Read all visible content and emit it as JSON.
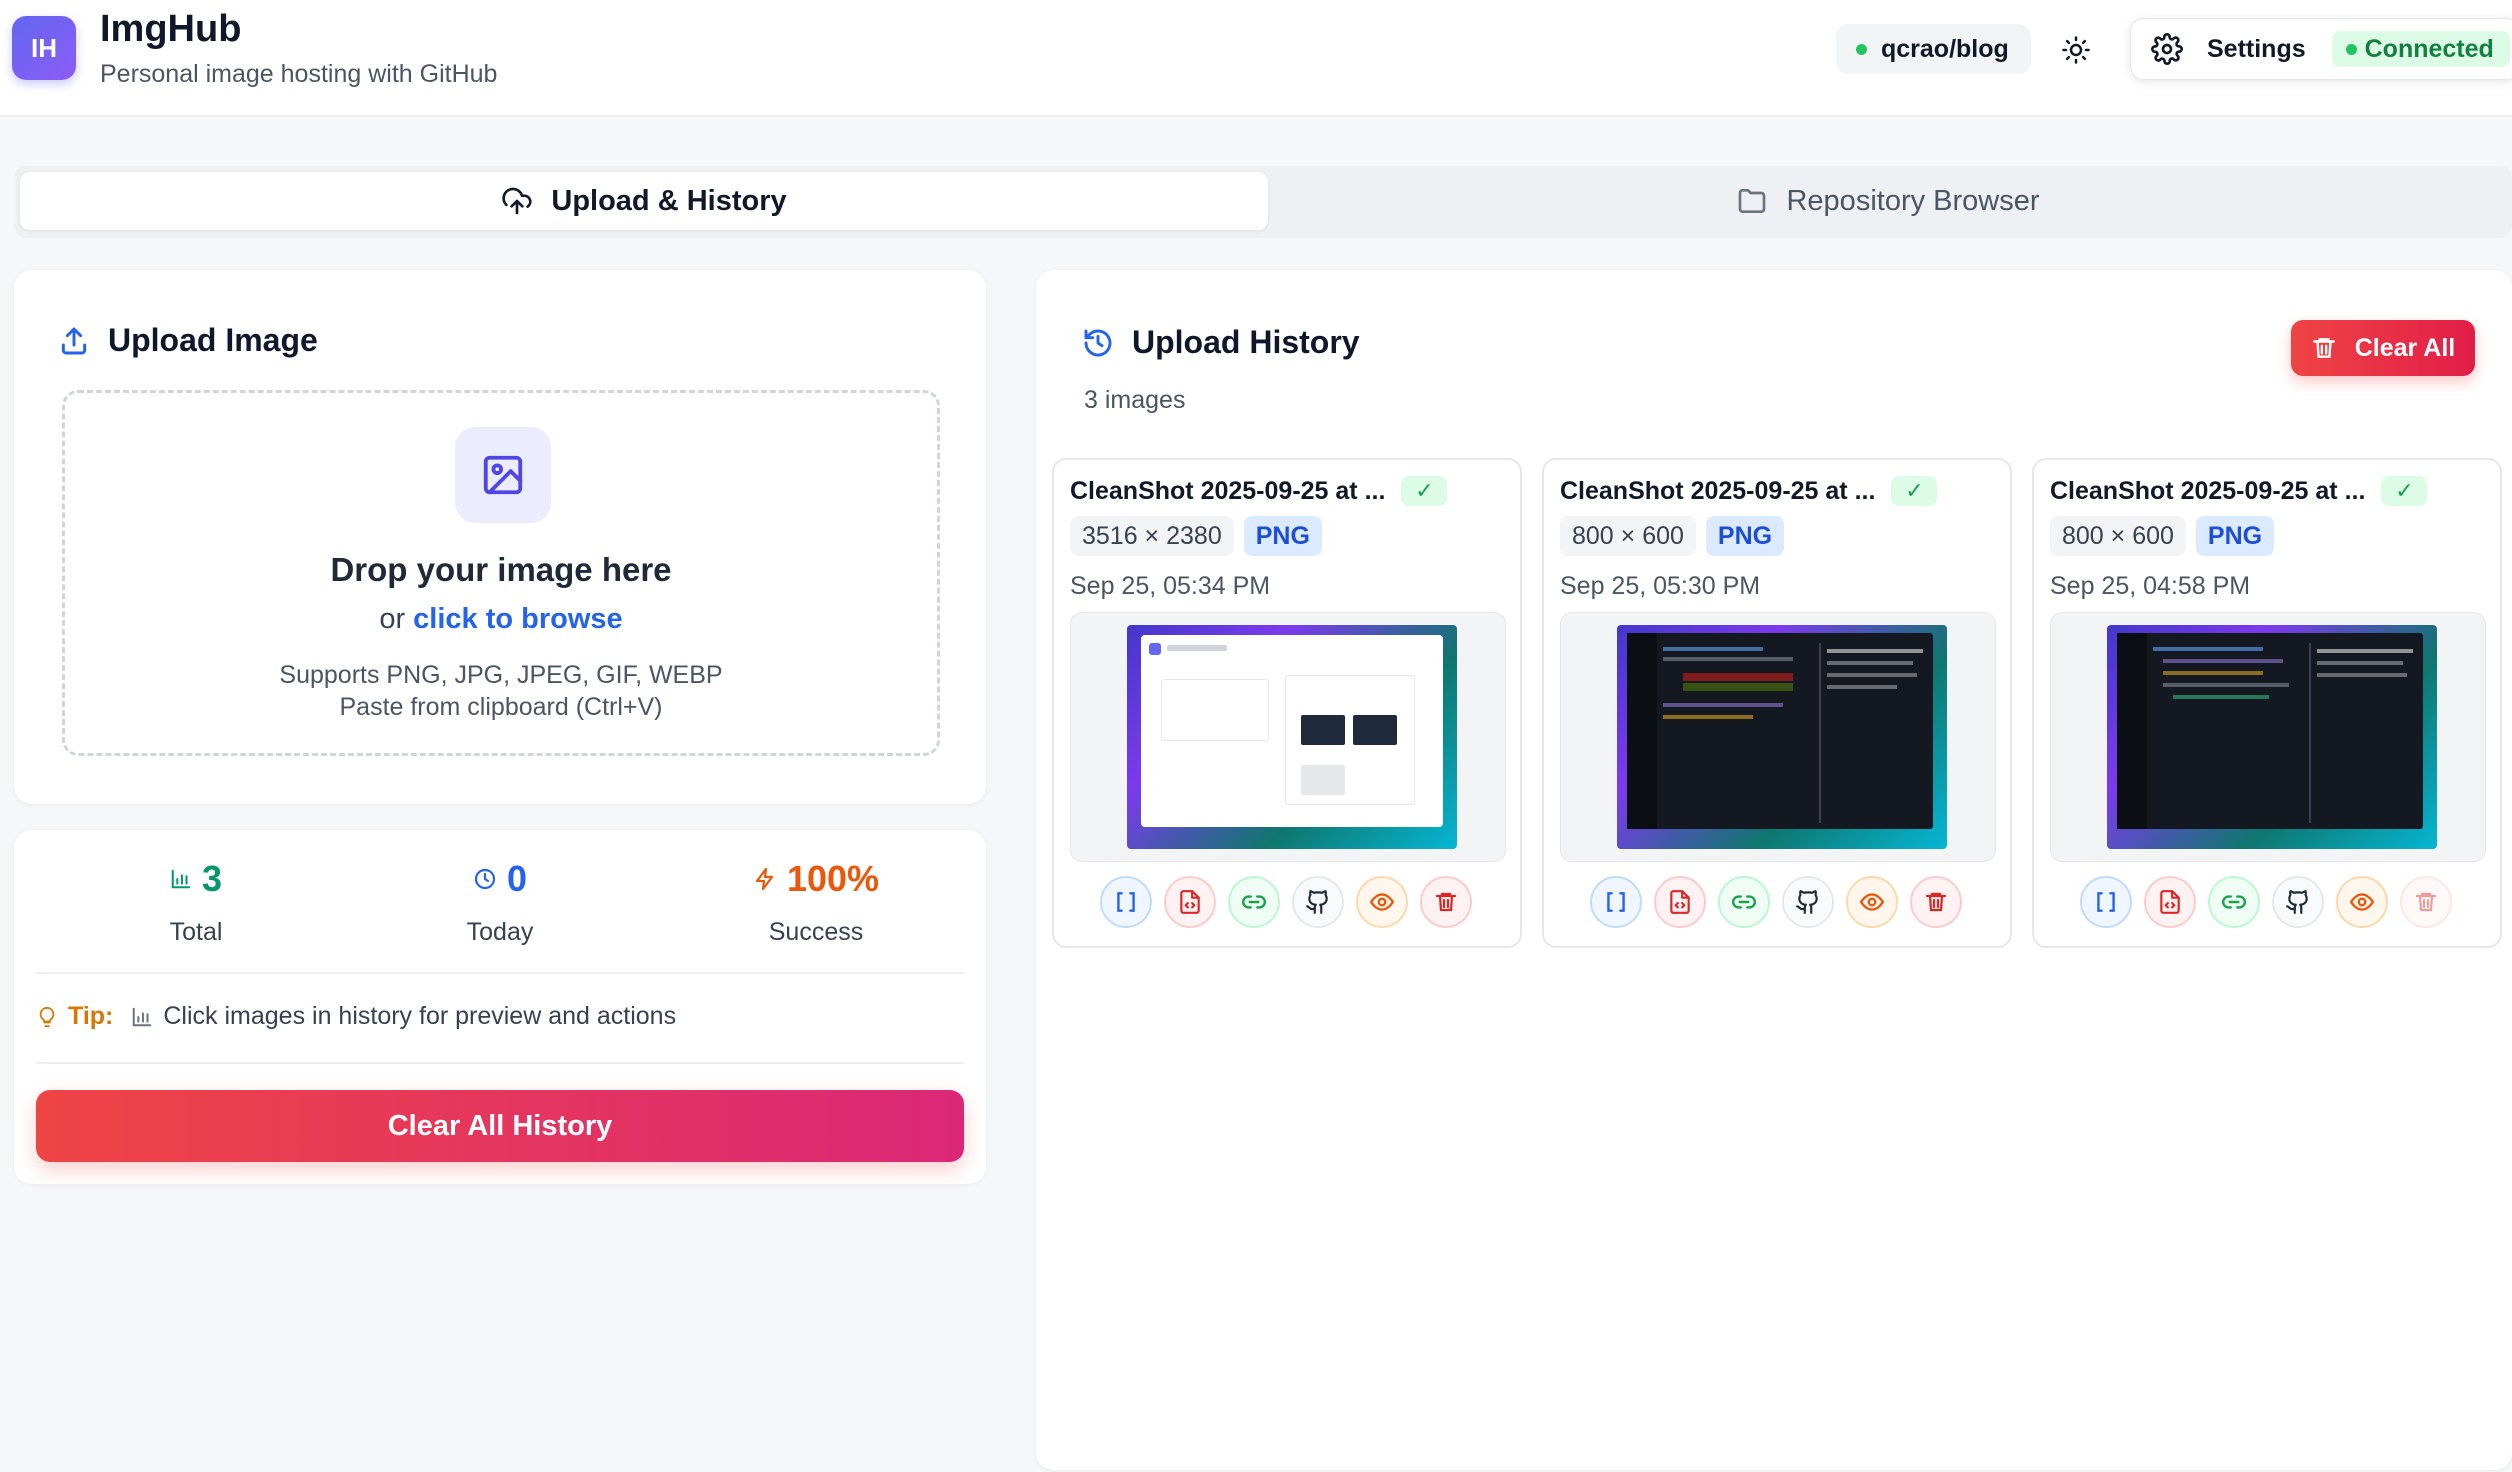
{
  "app": {
    "logo_text": "IH",
    "title": "ImgHub",
    "subtitle": "Personal image hosting with GitHub"
  },
  "header": {
    "repo": "qcrao/blog",
    "settings_label": "Settings",
    "status": "Connected",
    "colors": {
      "status_dot": "#22c55e",
      "brand": "#6366f1"
    }
  },
  "tabs": [
    {
      "label": "Upload & History",
      "icon": "upload-cloud-icon",
      "active": true
    },
    {
      "label": "Repository Browser",
      "icon": "folder-icon",
      "active": false
    }
  ],
  "upload": {
    "title": "Upload Image",
    "drop_title": "Drop your image here",
    "browse_prefix": "or",
    "browse_link": "click to browse",
    "supports": "Supports PNG, JPG, JPEG, GIF, WEBP",
    "paste_hint": "Paste from clipboard (Ctrl+V)"
  },
  "stats": {
    "total": {
      "value": "3",
      "label": "Total",
      "color": "#059669"
    },
    "today": {
      "value": "0",
      "label": "Today",
      "color": "#2563eb"
    },
    "success": {
      "value": "100%",
      "label": "Success",
      "color": "#ea580c"
    },
    "tip_label": "Tip:",
    "tip_text": "Click images in history for preview and actions",
    "clear_history_label": "Clear All History"
  },
  "history": {
    "title": "Upload History",
    "count": "3 images",
    "clear_all_label": "Clear All",
    "items": [
      {
        "name": "CleanShot 2025-09-25 at ...",
        "dimensions": "3516 × 2380",
        "format": "PNG",
        "date": "Sep 25, 05:34 PM",
        "status": "✓",
        "theme": "light"
      },
      {
        "name": "CleanShot 2025-09-25 at ...",
        "dimensions": "800 × 600",
        "format": "PNG",
        "date": "Sep 25, 05:30 PM",
        "status": "✓",
        "theme": "dark"
      },
      {
        "name": "CleanShot 2025-09-25 at ...",
        "dimensions": "800 × 600",
        "format": "PNG",
        "date": "Sep 25, 04:58 PM",
        "status": "✓",
        "theme": "dark"
      }
    ],
    "actions": [
      "copy-brackets-icon",
      "copy-html-icon",
      "copy-link-icon",
      "github-icon",
      "preview-eye-icon",
      "delete-trash-icon"
    ]
  }
}
